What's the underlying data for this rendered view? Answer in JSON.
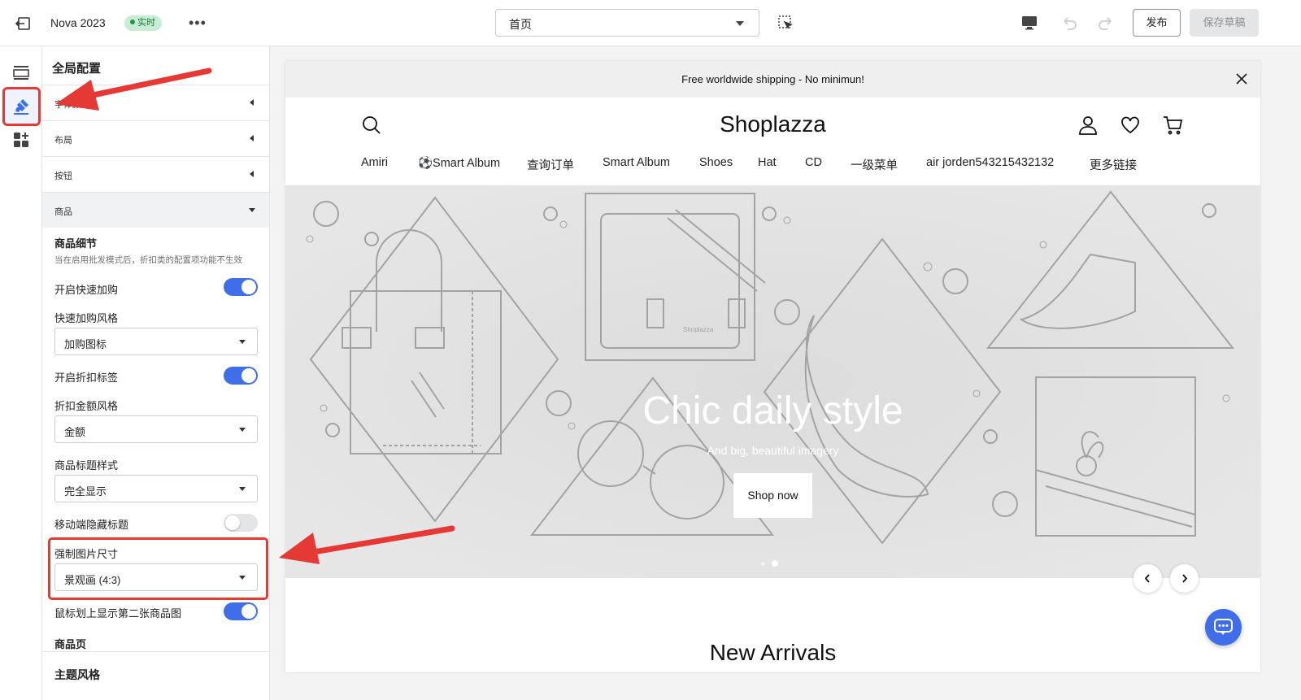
{
  "topbar": {
    "theme_name": "Nova 2023",
    "live_badge": "实时",
    "more_label": "•••",
    "page_select": "首页",
    "publish_label": "发布",
    "save_draft_label": "保存草稿"
  },
  "panel": {
    "title": "全局配置",
    "sections": [
      {
        "label": "字体颜色"
      },
      {
        "label": "布局"
      },
      {
        "label": "按钮"
      },
      {
        "label": "商品"
      }
    ],
    "product": {
      "details_title": "商品细节",
      "details_help": "当在启用批发模式后，折扣类的配置项功能不生效",
      "quick_add_label": "开启快速加购",
      "quick_add_on": true,
      "quick_add_style_label": "快速加购风格",
      "quick_add_style_value": "加购图标",
      "discount_tag_label": "开启折扣标签",
      "discount_tag_on": true,
      "discount_amount_style_label": "折扣金额风格",
      "discount_amount_style_value": "金额",
      "title_style_label": "商品标题样式",
      "title_style_value": "完全显示",
      "mobile_hide_title_label": "移动端隐藏标题",
      "mobile_hide_title_on": false,
      "force_image_size_label": "强制图片尺寸",
      "force_image_size_value": "景观画 (4:3)",
      "hover_second_image_label": "鼠标划上显示第二张商品图",
      "hover_second_image_on": true,
      "product_page_label": "商品页"
    },
    "footer_title": "主题风格"
  },
  "preview": {
    "announcement": "Free worldwide shipping - No minimun!",
    "logo": "Shoplazza",
    "nav": [
      "Amiri",
      "⚽Smart Album",
      "查询订单",
      "Smart Album",
      "Shoes",
      "Hat",
      "CD",
      "一级菜单",
      "air jorden543215432132",
      "更多链接"
    ],
    "hero_title": "Chic daily style",
    "hero_subtitle": "And big, beautiful imagery",
    "hero_button": "Shop now",
    "bag_brand": "Shoplazza",
    "section_title": "New Arrivals"
  },
  "colors": {
    "accent": "#3f6ee8",
    "annotation": "#e53935",
    "live_badge_bg": "#c8ecd6"
  }
}
